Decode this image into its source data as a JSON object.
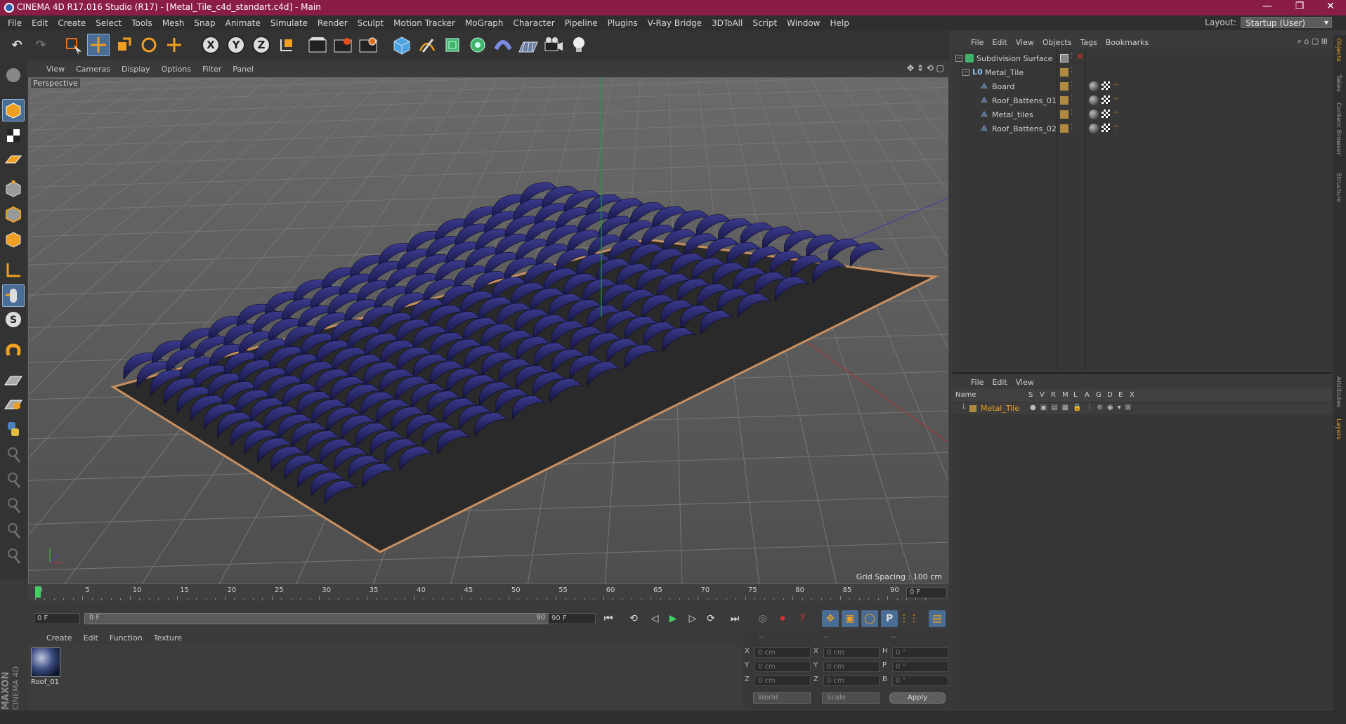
{
  "window": {
    "title": "CINEMA 4D R17.016 Studio (R17) - [Metal_Tile_c4d_standart.c4d] - Main",
    "min": "—",
    "restore": "❐",
    "close": "✕"
  },
  "menu": [
    "File",
    "Edit",
    "Create",
    "Select",
    "Tools",
    "Mesh",
    "Snap",
    "Animate",
    "Simulate",
    "Render",
    "Sculpt",
    "Motion Tracker",
    "MoGraph",
    "Character",
    "Pipeline",
    "Plugins",
    "V-Ray Bridge",
    "3DToAll",
    "Script",
    "Window",
    "Help"
  ],
  "layout": {
    "label": "Layout:",
    "value": "Startup (User)"
  },
  "toolbar": {
    "undo": "↶",
    "redo": "↷",
    "x": "X",
    "y": "Y",
    "z": "Z"
  },
  "viewport": {
    "menu": [
      "View",
      "Cameras",
      "Display",
      "Options",
      "Filter",
      "Panel"
    ],
    "camera": "Perspective",
    "grid_spacing": "Grid Spacing : 100 cm"
  },
  "timeline": {
    "ticks": [
      "0",
      "5",
      "10",
      "15",
      "20",
      "25",
      "30",
      "35",
      "40",
      "45",
      "50",
      "55",
      "60",
      "65",
      "70",
      "75",
      "80",
      "85",
      "90"
    ],
    "frame_right": "0 F",
    "start": "0 F",
    "range_start": "0 F",
    "range_end": "90 F",
    "end": "90 F"
  },
  "materials": {
    "menu": [
      "Create",
      "Edit",
      "Function",
      "Texture"
    ],
    "items": [
      {
        "name": "Roof_01"
      }
    ]
  },
  "coords": {
    "headers": [
      "--",
      "--",
      "--"
    ],
    "rows": [
      {
        "a": "X",
        "av": "0 cm",
        "b": "X",
        "bv": "0 cm",
        "c": "H",
        "cv": "0 °"
      },
      {
        "a": "Y",
        "av": "0 cm",
        "b": "Y",
        "bv": "0 cm",
        "c": "P",
        "cv": "0 °"
      },
      {
        "a": "Z",
        "av": "0 cm",
        "b": "Z",
        "bv": "0 cm",
        "c": "B",
        "cv": "0 °"
      }
    ],
    "world": "World",
    "scale": "Scale",
    "apply": "Apply"
  },
  "objects": {
    "menu": [
      "File",
      "Edit",
      "View",
      "Objects",
      "Tags",
      "Bookmarks"
    ],
    "rows": [
      {
        "name": "Subdivision Surface",
        "indent": 0
      },
      {
        "name": "Metal_Tile",
        "indent": 1
      },
      {
        "name": "Board",
        "indent": 2
      },
      {
        "name": "Roof_Battens_01",
        "indent": 2
      },
      {
        "name": "Metal_tiles",
        "indent": 2
      },
      {
        "name": "Roof_Battens_02",
        "indent": 2
      }
    ]
  },
  "layers": {
    "menu": [
      "File",
      "Edit",
      "View"
    ],
    "header": {
      "name": "Name",
      "cols": [
        "S",
        "V",
        "R",
        "M",
        "L",
        "A",
        "G",
        "D",
        "E",
        "X"
      ]
    },
    "rows": [
      {
        "name": "Metal_Tile"
      }
    ]
  },
  "sidetabs": [
    "Objects",
    "Takes",
    "Content Browser",
    "Structure",
    "Attributes",
    "Layers"
  ],
  "brand": {
    "maxon": "MAXON",
    "product": "CINEMA 4D"
  }
}
